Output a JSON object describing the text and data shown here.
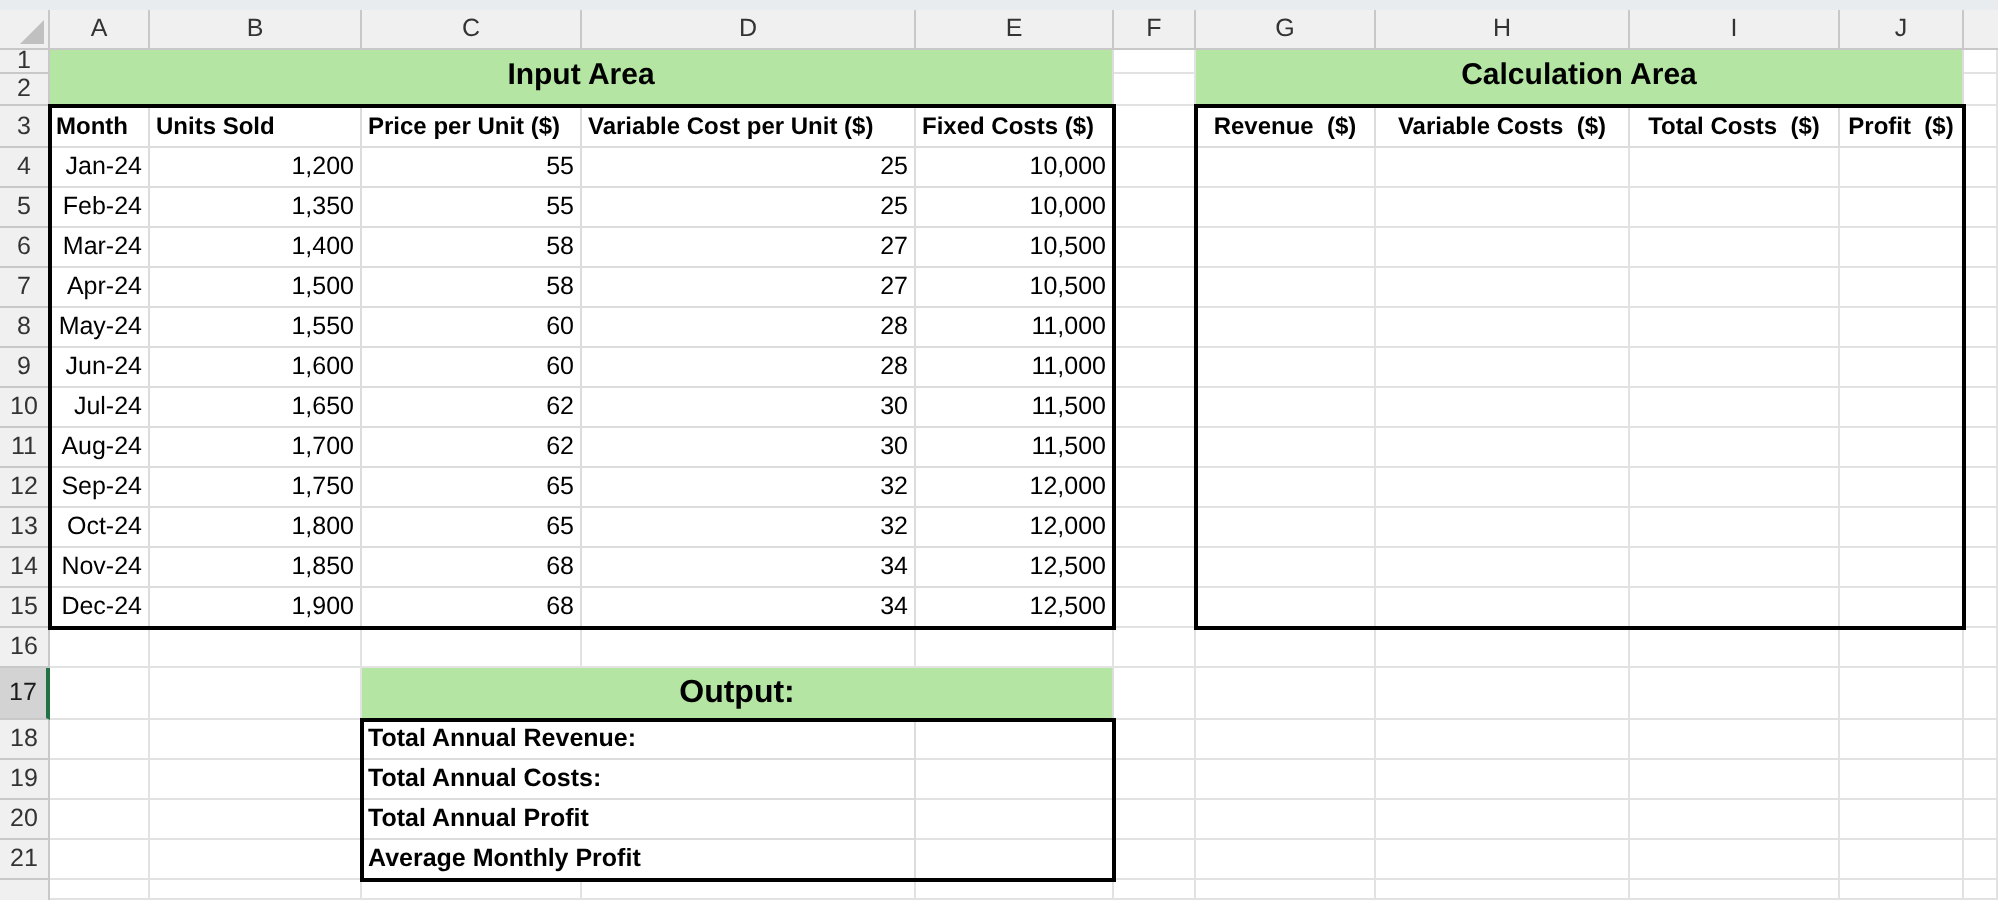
{
  "columns": [
    {
      "label": "A"
    },
    {
      "label": "B"
    },
    {
      "label": "C"
    },
    {
      "label": "D"
    },
    {
      "label": "E"
    },
    {
      "label": "F"
    },
    {
      "label": "G"
    },
    {
      "label": "H"
    },
    {
      "label": "I"
    },
    {
      "label": "J"
    }
  ],
  "rows": [
    {
      "label": "1",
      "selected": false
    },
    {
      "label": "2",
      "selected": false
    },
    {
      "label": "3",
      "selected": false
    },
    {
      "label": "4",
      "selected": false
    },
    {
      "label": "5",
      "selected": false
    },
    {
      "label": "6",
      "selected": false
    },
    {
      "label": "7",
      "selected": false
    },
    {
      "label": "8",
      "selected": false
    },
    {
      "label": "9",
      "selected": false
    },
    {
      "label": "10",
      "selected": false
    },
    {
      "label": "11",
      "selected": false
    },
    {
      "label": "12",
      "selected": false
    },
    {
      "label": "13",
      "selected": false
    },
    {
      "label": "14",
      "selected": false
    },
    {
      "label": "15",
      "selected": false
    },
    {
      "label": "16",
      "selected": false
    },
    {
      "label": "17",
      "selected": true
    },
    {
      "label": "18",
      "selected": false
    },
    {
      "label": "19",
      "selected": false
    },
    {
      "label": "20",
      "selected": false
    },
    {
      "label": "21",
      "selected": false
    }
  ],
  "input_area": {
    "title": "Input Area",
    "headers": [
      "Month",
      "Units Sold",
      "Price per Unit ($)",
      "Variable Cost per Unit ($)",
      "Fixed Costs ($)"
    ],
    "rows": [
      [
        "Jan-24",
        "1,200",
        "55",
        "25",
        "10,000"
      ],
      [
        "Feb-24",
        "1,350",
        "55",
        "25",
        "10,000"
      ],
      [
        "Mar-24",
        "1,400",
        "58",
        "27",
        "10,500"
      ],
      [
        "Apr-24",
        "1,500",
        "58",
        "27",
        "10,500"
      ],
      [
        "May-24",
        "1,550",
        "60",
        "28",
        "11,000"
      ],
      [
        "Jun-24",
        "1,600",
        "60",
        "28",
        "11,000"
      ],
      [
        "Jul-24",
        "1,650",
        "62",
        "30",
        "11,500"
      ],
      [
        "Aug-24",
        "1,700",
        "62",
        "30",
        "11,500"
      ],
      [
        "Sep-24",
        "1,750",
        "65",
        "32",
        "12,000"
      ],
      [
        "Oct-24",
        "1,800",
        "65",
        "32",
        "12,000"
      ],
      [
        "Nov-24",
        "1,850",
        "68",
        "34",
        "12,500"
      ],
      [
        "Dec-24",
        "1,900",
        "68",
        "34",
        "12,500"
      ]
    ]
  },
  "calculation_area": {
    "title": "Calculation Area",
    "headers": [
      "Revenue  ($)",
      "Variable Costs  ($)",
      "Total Costs  ($)",
      "Profit  ($)"
    ]
  },
  "output": {
    "title": "Output:",
    "labels": [
      "Total Annual Revenue:",
      "Total Annual Costs:",
      "Total Annual Profit",
      "Average Monthly Profit"
    ]
  }
}
